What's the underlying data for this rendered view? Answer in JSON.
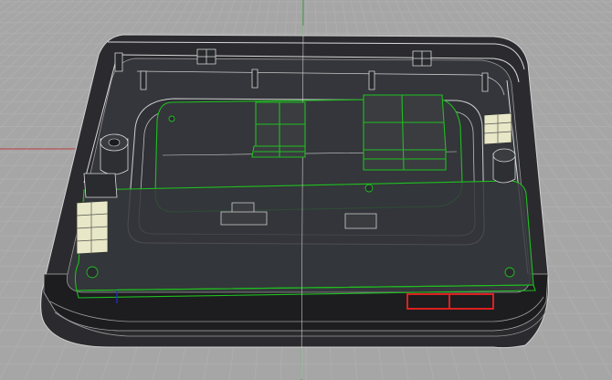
{
  "viewport": {
    "name": "Perspective",
    "background": "#a6a6a6",
    "grid_color": "#b5b5b5",
    "grid_major_color": "#8f8f8f",
    "x_axis_color": "#c04040",
    "y_axis_color": "#3a9a3a",
    "selection_color": "#1fbf1f"
  },
  "model": {
    "enclosure_color": "#2b2b2f",
    "enclosure_rim_color": "#1c1c1f",
    "board_color": "#34363b",
    "block_color": "#3a3c40",
    "highlight_component_color": "#e8e8c8",
    "red_component_color": "#dd2020"
  }
}
